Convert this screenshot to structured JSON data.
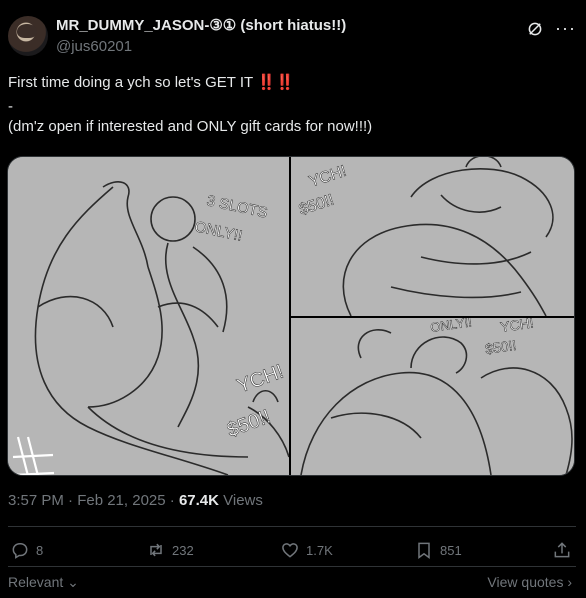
{
  "author": {
    "name": "MR_DUMMY_JASON-③① (short hiatus!!)",
    "handle": "@jus60201"
  },
  "tweet": {
    "line1": "First time doing a ych so let's GET IT ‼️‼️",
    "line2": "-",
    "line3": "(dm'z open if interested and ONLY gift cards for now!!!)"
  },
  "media": {
    "panel1": {
      "text1": "3 SLOTS",
      "text2": "ONLY!!",
      "text3": "YCH!",
      "text4": "$50!!"
    },
    "panel2": {
      "text1": "YCH!",
      "text2": "$50!!"
    },
    "panel3": {
      "text1": "ONLY!!",
      "text2": "YCH!",
      "text3": "$50!!"
    }
  },
  "meta": {
    "time": "3:57 PM · Feb 21, 2025 · ",
    "views": "67.4K",
    "views_label": " Views"
  },
  "actions": {
    "replies": "8",
    "reposts": "232",
    "likes": "1.7K",
    "bookmarks": "851"
  },
  "footer": {
    "sort": "Relevant",
    "quotes": "View quotes"
  },
  "colors": {
    "background": "#000000",
    "text": "#e7e9ea",
    "muted": "#71767b",
    "divider": "#2f3336",
    "accent_red": "#f4212e"
  }
}
